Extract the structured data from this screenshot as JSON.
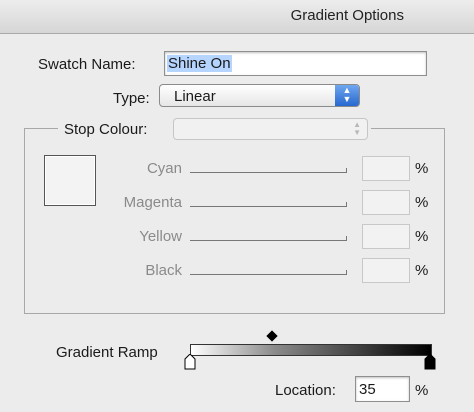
{
  "window": {
    "title": "Gradient Options"
  },
  "swatch_name": {
    "label": "Swatch Name:",
    "value": "Shine On"
  },
  "type": {
    "label": "Type:",
    "selected": "Linear"
  },
  "stop_colour": {
    "label": "Stop Colour:",
    "selected": "",
    "channels": [
      {
        "label": "Cyan",
        "value": "",
        "unit": "%"
      },
      {
        "label": "Magenta",
        "value": "",
        "unit": "%"
      },
      {
        "label": "Yellow",
        "value": "",
        "unit": "%"
      },
      {
        "label": "Black",
        "value": "",
        "unit": "%"
      }
    ]
  },
  "gradient_ramp": {
    "label": "Gradient Ramp",
    "midpoint_percent": 35,
    "stops": [
      {
        "position_percent": 0,
        "color": "#ffffff"
      },
      {
        "position_percent": 100,
        "color": "#000000"
      }
    ]
  },
  "location": {
    "label": "Location:",
    "value": "35",
    "unit": "%"
  },
  "colors": {
    "selection_highlight": "#b5d5ff",
    "popup_arrow_accent": "#2767cf"
  }
}
